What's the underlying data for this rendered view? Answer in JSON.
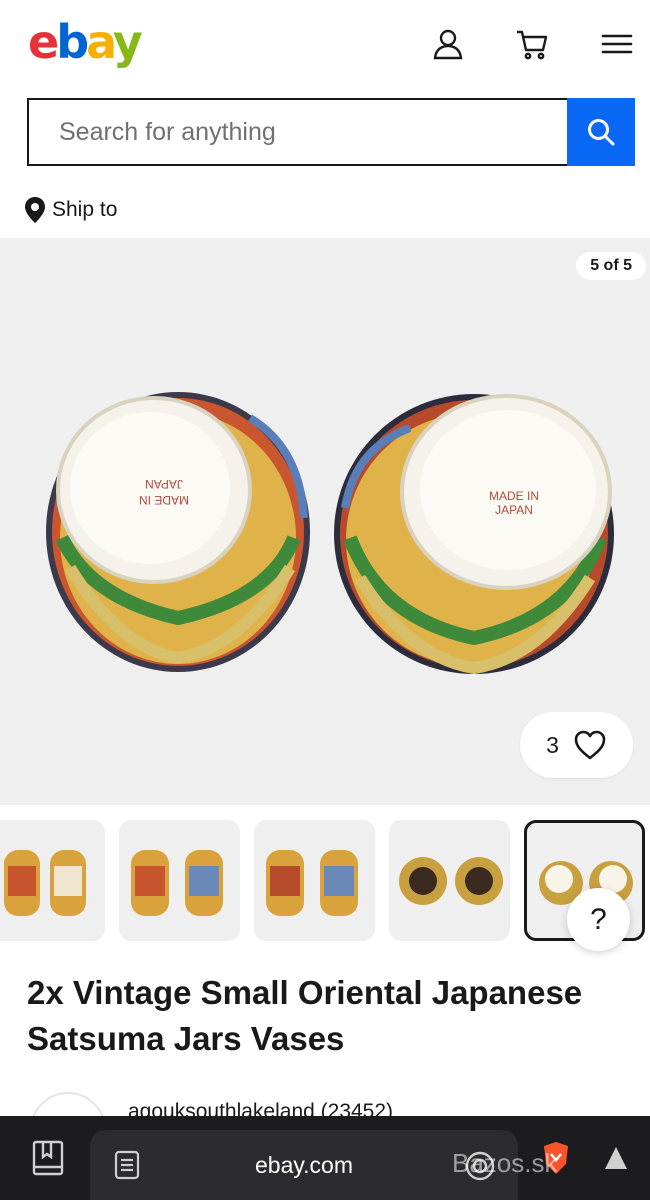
{
  "header": {
    "logo": [
      "e",
      "b",
      "a",
      "y"
    ],
    "icons": [
      "account-icon",
      "cart-icon",
      "menu-icon"
    ]
  },
  "search": {
    "placeholder": "Search for anything",
    "button_icon": "search-icon"
  },
  "ship_to": {
    "label": "Ship to",
    "icon": "location-pin-icon"
  },
  "gallery": {
    "counter": "5 of 5",
    "main_image_texts": [
      "MADE IN JAPAN",
      "MADE IN JAPAN"
    ],
    "watchers": "3",
    "like_icon": "heart-icon"
  },
  "thumbnails": {
    "count": 5,
    "active_index": 5
  },
  "help": {
    "label": "?"
  },
  "listing": {
    "title": "2x Vintage Small Oriental Japanese Satsuma Jars Vases"
  },
  "seller": {
    "name": "agouksouthlakeland (23452)"
  },
  "browser": {
    "url": "ebay.com",
    "watermark": "Bazos.sk"
  },
  "colors": {
    "ebay_red": "#e53238",
    "ebay_blue": "#0064d2",
    "ebay_yellow": "#f5af02",
    "ebay_green": "#86b817",
    "search_button": "#0968f6",
    "gallery_bg": "#efefef"
  }
}
